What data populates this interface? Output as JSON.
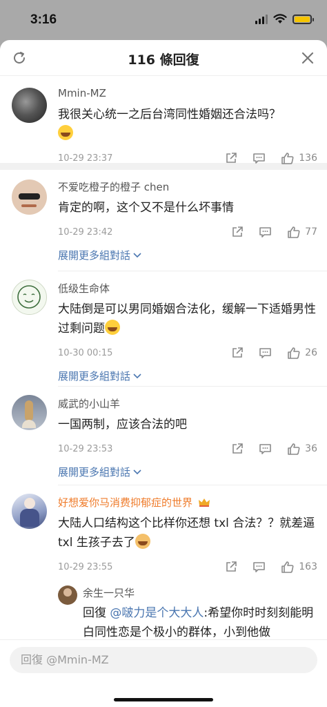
{
  "status": {
    "time": "3:16"
  },
  "sheet": {
    "title": "116 條回復"
  },
  "comments": [
    {
      "user": "Mmin-MZ",
      "text": "我很关心统一之后台湾同性婚姻还合法吗？",
      "emoji": "laughing-crying-emoji",
      "time": "10-29 23:37",
      "likes": "136"
    },
    {
      "user": "不爱吃橙子的橙子 chen",
      "text": "肯定的啊，这个又不是什么坏事情",
      "time": "10-29 23:42",
      "likes": "77",
      "expand": "展開更多組對話"
    },
    {
      "user": "低级生命体",
      "text": "大陆倒是可以男同婚姻合法化，缓解一下适婚男性过剩问题",
      "emoji": "laughing-crying-emoji",
      "time": "10-30 00:15",
      "likes": "26",
      "expand": "展開更多組對話"
    },
    {
      "user": "威武的小山羊",
      "text": "一国两制，应该合法的吧",
      "time": "10-29 23:53",
      "likes": "36",
      "expand": "展開更多組對話"
    },
    {
      "user": "好想爱你马消费抑郁症的世界",
      "badge": "crown-icon",
      "text": "大陆人口结构这个比样你还想 txl 合法？？就差逼 txl 生孩子去了",
      "emoji": "doge-emoji",
      "time": "10-29 23:55",
      "likes": "163"
    }
  ],
  "reply": {
    "user": "余生一只华",
    "prefix": "回復 ",
    "mention": "@啵力是个大大人",
    "text": ":希望你时时刻刻能明白同性恋是个极小的群体，小到他做"
  },
  "input": {
    "placeholder": "回復 @Mmin-MZ"
  },
  "colors": {
    "accent_link": "#4a76b0",
    "hot_user": "#ef7b2a",
    "emoji": "#ffcf3c"
  }
}
